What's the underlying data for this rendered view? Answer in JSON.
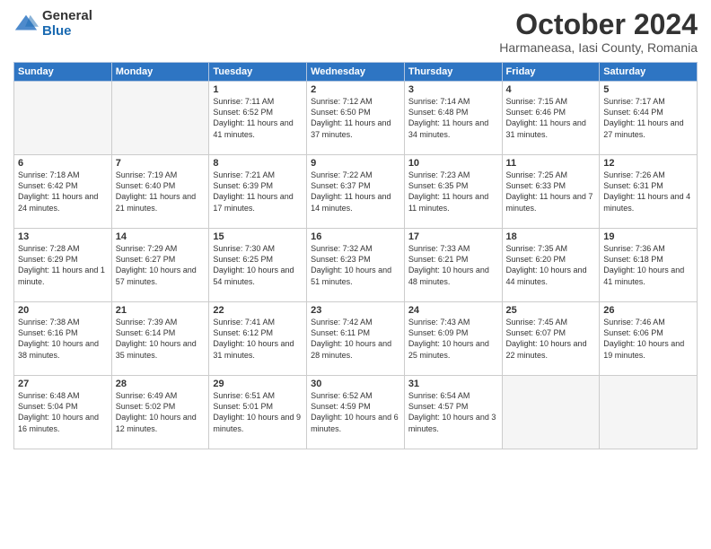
{
  "header": {
    "logo_general": "General",
    "logo_blue": "Blue",
    "title": "October 2024",
    "location": "Harmaneasa, Iasi County, Romania"
  },
  "weekdays": [
    "Sunday",
    "Monday",
    "Tuesday",
    "Wednesday",
    "Thursday",
    "Friday",
    "Saturday"
  ],
  "days": [
    {
      "num": "",
      "info": "",
      "empty": true
    },
    {
      "num": "",
      "info": "",
      "empty": true
    },
    {
      "num": "1",
      "info": "Sunrise: 7:11 AM\nSunset: 6:52 PM\nDaylight: 11 hours and 41 minutes."
    },
    {
      "num": "2",
      "info": "Sunrise: 7:12 AM\nSunset: 6:50 PM\nDaylight: 11 hours and 37 minutes."
    },
    {
      "num": "3",
      "info": "Sunrise: 7:14 AM\nSunset: 6:48 PM\nDaylight: 11 hours and 34 minutes."
    },
    {
      "num": "4",
      "info": "Sunrise: 7:15 AM\nSunset: 6:46 PM\nDaylight: 11 hours and 31 minutes."
    },
    {
      "num": "5",
      "info": "Sunrise: 7:17 AM\nSunset: 6:44 PM\nDaylight: 11 hours and 27 minutes."
    },
    {
      "num": "6",
      "info": "Sunrise: 7:18 AM\nSunset: 6:42 PM\nDaylight: 11 hours and 24 minutes."
    },
    {
      "num": "7",
      "info": "Sunrise: 7:19 AM\nSunset: 6:40 PM\nDaylight: 11 hours and 21 minutes."
    },
    {
      "num": "8",
      "info": "Sunrise: 7:21 AM\nSunset: 6:39 PM\nDaylight: 11 hours and 17 minutes."
    },
    {
      "num": "9",
      "info": "Sunrise: 7:22 AM\nSunset: 6:37 PM\nDaylight: 11 hours and 14 minutes."
    },
    {
      "num": "10",
      "info": "Sunrise: 7:23 AM\nSunset: 6:35 PM\nDaylight: 11 hours and 11 minutes."
    },
    {
      "num": "11",
      "info": "Sunrise: 7:25 AM\nSunset: 6:33 PM\nDaylight: 11 hours and 7 minutes."
    },
    {
      "num": "12",
      "info": "Sunrise: 7:26 AM\nSunset: 6:31 PM\nDaylight: 11 hours and 4 minutes."
    },
    {
      "num": "13",
      "info": "Sunrise: 7:28 AM\nSunset: 6:29 PM\nDaylight: 11 hours and 1 minute."
    },
    {
      "num": "14",
      "info": "Sunrise: 7:29 AM\nSunset: 6:27 PM\nDaylight: 10 hours and 57 minutes."
    },
    {
      "num": "15",
      "info": "Sunrise: 7:30 AM\nSunset: 6:25 PM\nDaylight: 10 hours and 54 minutes."
    },
    {
      "num": "16",
      "info": "Sunrise: 7:32 AM\nSunset: 6:23 PM\nDaylight: 10 hours and 51 minutes."
    },
    {
      "num": "17",
      "info": "Sunrise: 7:33 AM\nSunset: 6:21 PM\nDaylight: 10 hours and 48 minutes."
    },
    {
      "num": "18",
      "info": "Sunrise: 7:35 AM\nSunset: 6:20 PM\nDaylight: 10 hours and 44 minutes."
    },
    {
      "num": "19",
      "info": "Sunrise: 7:36 AM\nSunset: 6:18 PM\nDaylight: 10 hours and 41 minutes."
    },
    {
      "num": "20",
      "info": "Sunrise: 7:38 AM\nSunset: 6:16 PM\nDaylight: 10 hours and 38 minutes."
    },
    {
      "num": "21",
      "info": "Sunrise: 7:39 AM\nSunset: 6:14 PM\nDaylight: 10 hours and 35 minutes."
    },
    {
      "num": "22",
      "info": "Sunrise: 7:41 AM\nSunset: 6:12 PM\nDaylight: 10 hours and 31 minutes."
    },
    {
      "num": "23",
      "info": "Sunrise: 7:42 AM\nSunset: 6:11 PM\nDaylight: 10 hours and 28 minutes."
    },
    {
      "num": "24",
      "info": "Sunrise: 7:43 AM\nSunset: 6:09 PM\nDaylight: 10 hours and 25 minutes."
    },
    {
      "num": "25",
      "info": "Sunrise: 7:45 AM\nSunset: 6:07 PM\nDaylight: 10 hours and 22 minutes."
    },
    {
      "num": "26",
      "info": "Sunrise: 7:46 AM\nSunset: 6:06 PM\nDaylight: 10 hours and 19 minutes."
    },
    {
      "num": "27",
      "info": "Sunrise: 6:48 AM\nSunset: 5:04 PM\nDaylight: 10 hours and 16 minutes."
    },
    {
      "num": "28",
      "info": "Sunrise: 6:49 AM\nSunset: 5:02 PM\nDaylight: 10 hours and 12 minutes."
    },
    {
      "num": "29",
      "info": "Sunrise: 6:51 AM\nSunset: 5:01 PM\nDaylight: 10 hours and 9 minutes."
    },
    {
      "num": "30",
      "info": "Sunrise: 6:52 AM\nSunset: 4:59 PM\nDaylight: 10 hours and 6 minutes."
    },
    {
      "num": "31",
      "info": "Sunrise: 6:54 AM\nSunset: 4:57 PM\nDaylight: 10 hours and 3 minutes."
    },
    {
      "num": "",
      "info": "",
      "empty": true
    },
    {
      "num": "",
      "info": "",
      "empty": true
    }
  ]
}
